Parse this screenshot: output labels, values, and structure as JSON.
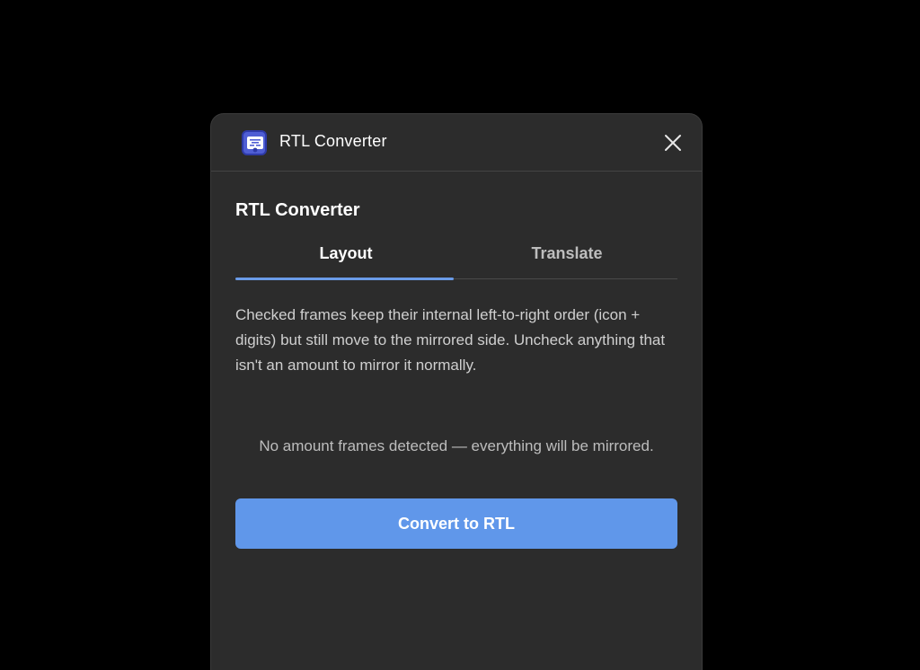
{
  "window": {
    "title": "RTL Converter",
    "icon": "rtl-converter-app-icon",
    "close_icon": "close-icon"
  },
  "main": {
    "section_title": "RTL Converter",
    "tabs": [
      {
        "label": "Layout",
        "active": true
      },
      {
        "label": "Translate",
        "active": false
      }
    ],
    "description": "Checked frames keep their internal left-to-right order (icon + digits) but still move to the mirrored side. Uncheck anything that isn't an amount to mirror it normally.",
    "empty_state": "No amount frames detected — everything will be mirrored.",
    "convert_button_label": "Convert to RTL"
  },
  "colors": {
    "page_background": "#000000",
    "panel_background": "#2c2c2c",
    "accent": "#6097ea",
    "tab_indicator": "#6a9be8",
    "app_icon": "#4f5ed4"
  }
}
